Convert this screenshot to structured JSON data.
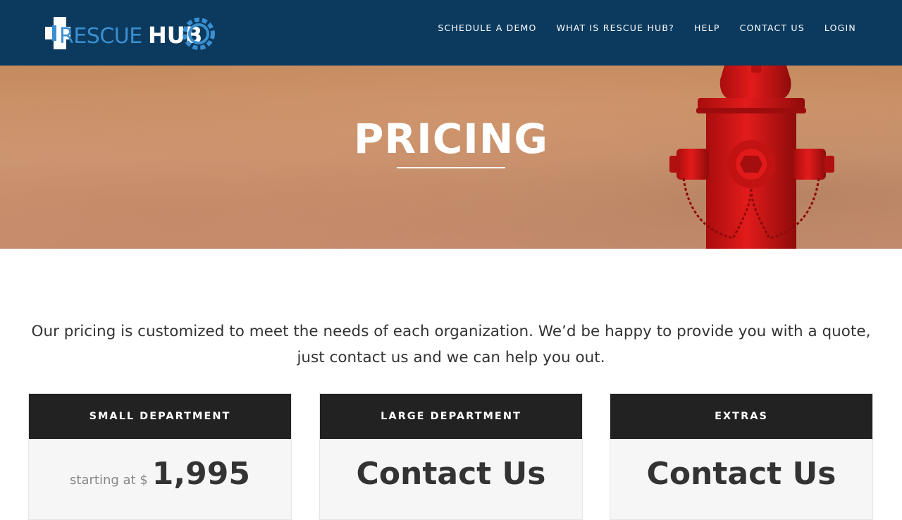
{
  "logo": {
    "text_rescue": "RESCUE",
    "text_hub": "HUB"
  },
  "nav": {
    "items": [
      {
        "label": "SCHEDULE A DEMO"
      },
      {
        "label": "WHAT IS RESCUE HUB?"
      },
      {
        "label": "HELP"
      },
      {
        "label": "CONTACT US"
      },
      {
        "label": "LOGIN"
      }
    ]
  },
  "hero": {
    "title": "PRICING"
  },
  "intro": {
    "text": "Our pricing is customized to meet the needs of each organization. We’d be happy to provide you with a quote, just contact us and we can help you out."
  },
  "cards": [
    {
      "title": "SMALL DEPARTMENT",
      "price_prefix": "starting at $",
      "price_value": "1,995"
    },
    {
      "title": "LARGE DEPARTMENT",
      "price_text": "Contact Us"
    },
    {
      "title": "EXTRAS",
      "price_text": "Contact Us"
    }
  ],
  "colors": {
    "header_bg": "#0c3a5e",
    "logo_blue": "#3a8fd0",
    "card_head_bg": "#222222",
    "hydrant_red": "#d21414"
  },
  "icons": {
    "logo_cross": "cross-icon",
    "logo_gear": "gear-icon"
  }
}
